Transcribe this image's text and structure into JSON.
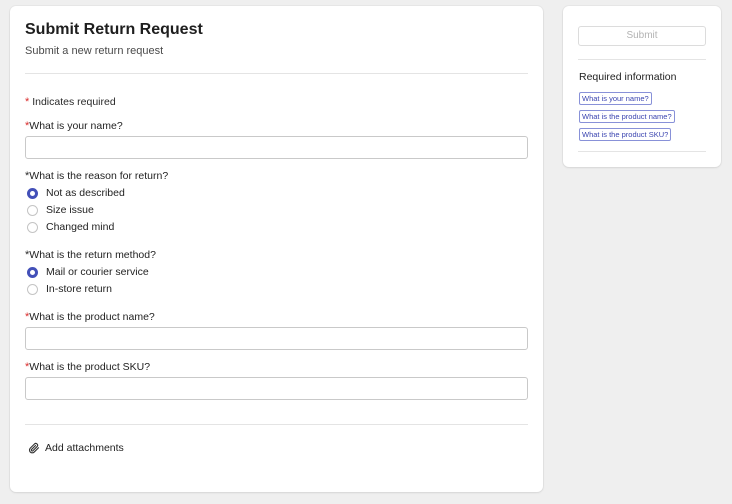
{
  "form": {
    "title": "Submit Return Request",
    "subtitle": "Submit a new return request",
    "required_marker": "*",
    "required_note": "Indicates required",
    "name_question": "What is your name?",
    "name_value": "",
    "reason_question": "What is the reason for return?",
    "reason_options": [
      "Not as described",
      "Size issue",
      "Changed mind"
    ],
    "reason_selected": "Not as described",
    "method_question": "What is the return method?",
    "method_options": [
      "Mail or courier service",
      "In-store return"
    ],
    "method_selected": "Mail or courier service",
    "product_question": "What is the product name?",
    "product_value": "",
    "sku_question": "What is the product SKU?",
    "sku_value": "",
    "attach_label": "Add attachments"
  },
  "sidebar": {
    "submit_label": "Submit",
    "required_title": "Required information",
    "required_items": [
      "What is your name?",
      "What is the product name?",
      "What is the product SKU?"
    ]
  },
  "colors": {
    "accent": "#4350b8",
    "required_star": "#d92b2b",
    "background": "#efefef"
  },
  "icons": {
    "attach": "paperclip-icon"
  }
}
